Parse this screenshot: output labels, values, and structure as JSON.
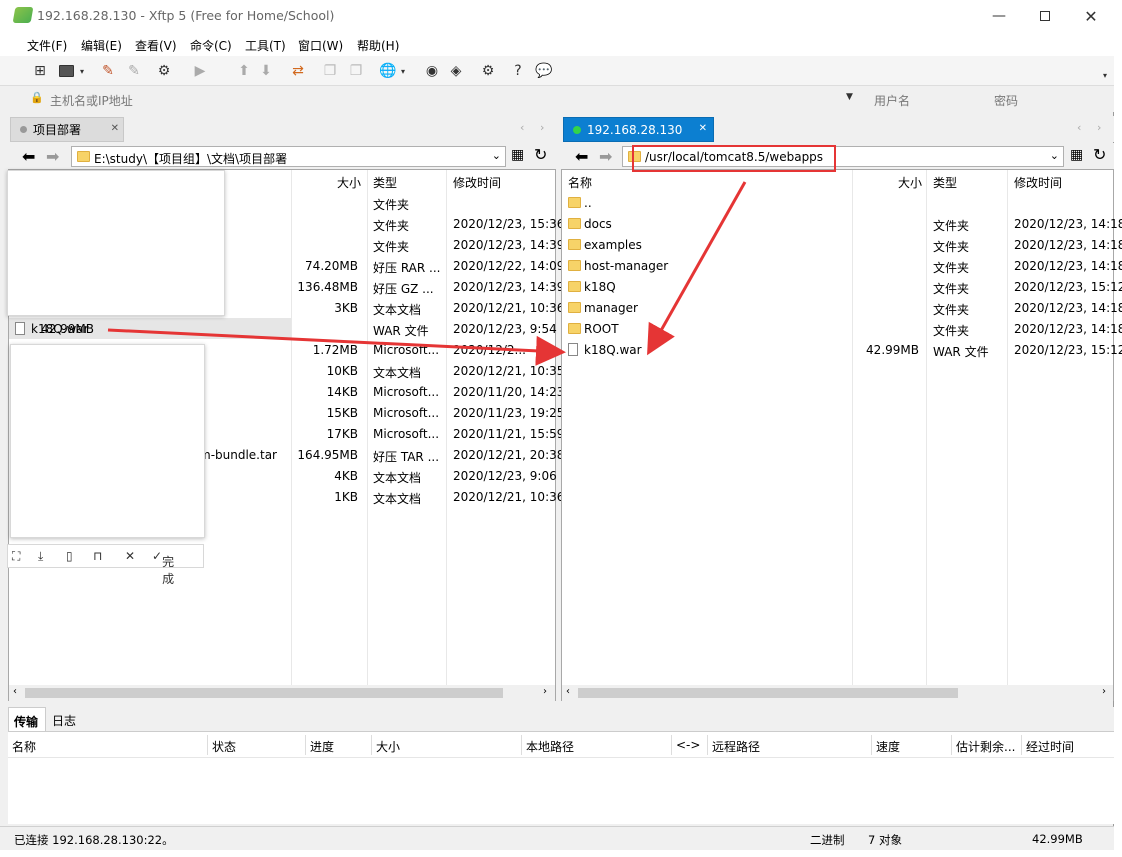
{
  "window": {
    "title": "192.168.28.130  - Xftp 5 (Free for Home/School)"
  },
  "menu": [
    "文件(F)",
    "编辑(E)",
    "查看(V)",
    "命令(C)",
    "工具(T)",
    "窗口(W)",
    "帮助(H)"
  ],
  "addr": {
    "host_placeholder": "主机名或IP地址",
    "user_placeholder": "用户名",
    "pass_placeholder": "密码"
  },
  "left": {
    "tab": "项目部署",
    "path": "E:\\study\\【项目组】\\文档\\项目部署",
    "headers": {
      "size": "大小",
      "type": "类型",
      "mtime": "修改时间"
    },
    "rows": [
      {
        "name": "",
        "size": "",
        "type": "文件夹",
        "mtime": ""
      },
      {
        "name": "",
        "size": "",
        "type": "文件夹",
        "mtime": "2020/12/23, 15:36"
      },
      {
        "name": "",
        "size": "",
        "type": "文件夹",
        "mtime": "2020/12/23, 14:39"
      },
      {
        "name": "",
        "size": "74.20MB",
        "type": "好压 RAR ...",
        "mtime": "2020/12/22, 14:09"
      },
      {
        "name": "",
        "size": "136.48MB",
        "type": "好压 GZ ...",
        "mtime": "2020/12/23, 14:39"
      },
      {
        "name": "",
        "size": "3KB",
        "type": "文本文档",
        "mtime": "2020/12/21, 10:36"
      },
      {
        "name": "k18Q.war",
        "size": "42.99MB",
        "type": "WAR 文件",
        "mtime": "2020/12/23, 9:54"
      },
      {
        "name": "",
        "size": "1.72MB",
        "type": "Microsoft...",
        "mtime": "2020/12/2..."
      },
      {
        "name": "",
        "size": "10KB",
        "type": "文本文档",
        "mtime": "2020/12/21, 10:35"
      },
      {
        "name": "",
        "size": "14KB",
        "type": "Microsoft...",
        "mtime": "2020/11/20, 14:23"
      },
      {
        "name": "",
        "size": "15KB",
        "type": "Microsoft...",
        "mtime": "2020/11/23, 19:25"
      },
      {
        "name": "",
        "size": "17KB",
        "type": "Microsoft...",
        "mtime": "2020/11/21, 15:59"
      },
      {
        "name": "m-bundle.tar",
        "size": "164.95MB",
        "type": "好压 TAR ...",
        "mtime": "2020/12/21, 20:38"
      },
      {
        "name": "",
        "size": "4KB",
        "type": "文本文档",
        "mtime": "2020/12/23, 9:06"
      },
      {
        "name": "",
        "size": "1KB",
        "type": "文本文档",
        "mtime": "2020/12/21, 10:36"
      }
    ]
  },
  "right": {
    "tab": "192.168.28.130",
    "path": "/usr/local/tomcat8.5/webapps",
    "headers": {
      "name": "名称",
      "size": "大小",
      "type": "类型",
      "mtime": "修改时间"
    },
    "rows": [
      {
        "name": "..",
        "size": "",
        "type": "",
        "mtime": ""
      },
      {
        "name": "docs",
        "size": "",
        "type": "文件夹",
        "mtime": "2020/12/23, 14:18"
      },
      {
        "name": "examples",
        "size": "",
        "type": "文件夹",
        "mtime": "2020/12/23, 14:18"
      },
      {
        "name": "host-manager",
        "size": "",
        "type": "文件夹",
        "mtime": "2020/12/23, 14:18"
      },
      {
        "name": "k18Q",
        "size": "",
        "type": "文件夹",
        "mtime": "2020/12/23, 15:12"
      },
      {
        "name": "manager",
        "size": "",
        "type": "文件夹",
        "mtime": "2020/12/23, 14:18"
      },
      {
        "name": "ROOT",
        "size": "",
        "type": "文件夹",
        "mtime": "2020/12/23, 14:18"
      },
      {
        "name": "k18Q.war",
        "size": "42.99MB",
        "type": "WAR 文件",
        "mtime": "2020/12/23, 15:12"
      }
    ]
  },
  "transfer": {
    "tabs": [
      "传输",
      "日志"
    ],
    "headers": [
      "名称",
      "状态",
      "进度",
      "大小",
      "本地路径",
      "<->",
      "远程路径",
      "速度",
      "估计剩余...",
      "经过时间"
    ]
  },
  "screenshot_toolbar": {
    "done": "完成"
  },
  "status": {
    "conn": "已连接 192.168.28.130:22。",
    "mode": "二进制",
    "count": "7 对象",
    "size": "42.99MB"
  },
  "colors": {
    "accent": "#0078d7",
    "tab_active": "#0c7fd1",
    "annotation": "#e53535"
  }
}
